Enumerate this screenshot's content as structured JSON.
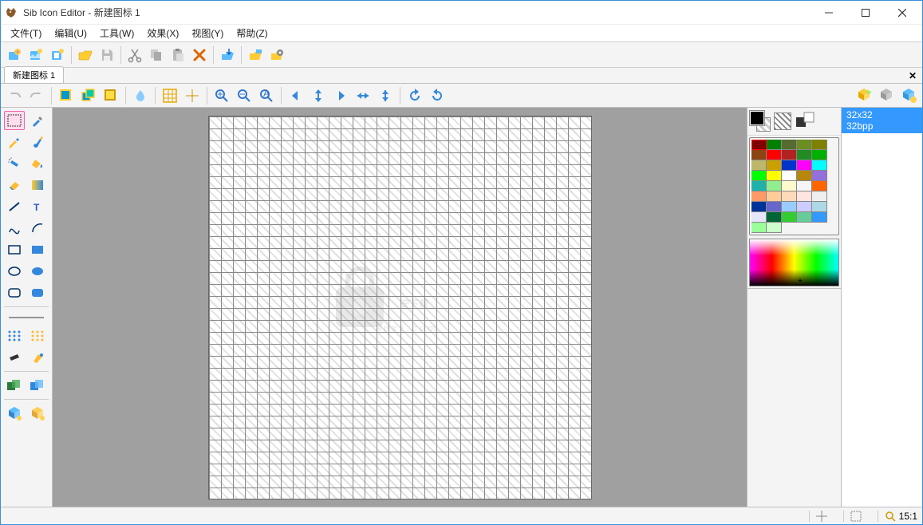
{
  "window": {
    "title": "Sib Icon Editor - 新建图标 1"
  },
  "menu": {
    "file": "文件(T)",
    "edit": "编辑(U)",
    "tools": "工具(W)",
    "effects": "效果(X)",
    "view": "视图(Y)",
    "help": "帮助(Z)"
  },
  "tabs": {
    "doc1": "新建图标 1"
  },
  "formats": {
    "size": "32x32",
    "bpp": "32bpp"
  },
  "status": {
    "zoom": "15:1"
  },
  "palette_colors": [
    "#800000",
    "#008000",
    "#808000",
    "#000080",
    "#800080",
    "#008080",
    "#c0c0c0",
    "#ff0000",
    "#00ff00",
    "#ffff00",
    "#0000ff",
    "#ff00ff",
    "#806040",
    "#408020",
    "#208060",
    "#204080",
    "#602080",
    "#c0c0c0",
    "#ff8040",
    "#80ff40",
    "#40ff80",
    "#4080ff",
    "#8040ff",
    "#ffffff",
    "#402000",
    "#004020",
    "#200040",
    "#ff8000",
    "#00ff80",
    "#8000ff",
    "#804020",
    "#208040",
    "#402080",
    "#ffc080",
    "#80ffc0",
    "#c080ff"
  ]
}
